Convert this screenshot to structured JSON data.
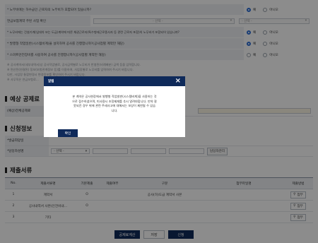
{
  "questions": [
    {
      "label": "* 노무비에는 하수급인 근로자의 노무비가 포함되어 있습니까?",
      "type": "radio",
      "yes": "예",
      "no": "아니오",
      "selected": "yes"
    },
    {
      "label": "연금보험계약 주된 사업 확인",
      "type": "select",
      "placeholder": "- 선택 -",
      "placeholder2": "- 선택 -"
    },
    {
      "label": "* 노무비에는 건설기계(임대차 또는 도급)계약에 따른 채권근로자(특수형태근로종사자 등 관련 근로자 포함)의 노무비가 포함되어 있습니까?",
      "type": "radio",
      "yes": "예",
      "no": "아니오",
      "selected": "yes"
    },
    {
      "label": "* 발행형 작업일반(시스템비계)을 설치하여 공사를 진행합니까?(공사업별 계약만 해당)",
      "type": "radio",
      "yes": "예",
      "no": "아니오",
      "selected": "yes"
    },
    {
      "label": "* 스마트안전장비를 사용하여 공사를 진행합니까?(공사업별 계약만 해당)",
      "type": "radio",
      "yes": "예",
      "no": "아니오",
      "selected": "none"
    }
  ],
  "notes": [
    "※ 공사계약서(세부내역서)상 공사작업별로, 공사금액별로 노무비가 반영된(비례배분) 금액 등을 입력합니다.",
    "※ 면산된(연결된) 정보(보험관계정보 등)를 이용하여, 사업장별로 노무비를 입력하여 주시기 바랍니다.",
    "   다만, 사업장 통합변경시 변경정보를 확인하여 주시기 바랍니다.",
    "※ 사무직은 연금보험료..."
  ],
  "section_premium": {
    "title": "예상 공제료",
    "row_label": "(예상)전체공제료",
    "right_label": "전체공제료"
  },
  "section_applicant": {
    "title": "신청정보",
    "row1_label": "*발급희망일",
    "row2_label": "*담당자성명",
    "select_placeholder": "- 선택 -",
    "lookup_button": "담당자관리"
  },
  "section_docs": {
    "title": "제출서류",
    "columns": [
      "No.",
      "제출서류명",
      "기본제출",
      "제출여부",
      "구분",
      "첨부파일명",
      "제출방법"
    ],
    "rows": [
      {
        "no": "1",
        "name": "계약서",
        "basic": "O",
        "submitted": "",
        "category": "공사(하)도급 계약서 사본",
        "file": "",
        "method": "첨부"
      },
      {
        "no": "2",
        "name": "공사내역서 사본(인건비내…",
        "basic": "O",
        "submitted": "",
        "category": "",
        "file": "",
        "method": "첨부"
      },
      {
        "no": "3",
        "name": "기타",
        "basic": "",
        "submitted": "",
        "category": "",
        "file": "",
        "method": "첨부"
      }
    ]
  },
  "bottom_buttons": {
    "calc": "공제료계산",
    "save": "저장",
    "apply": "신청"
  },
  "modal": {
    "title": "알림",
    "close": "×",
    "body_line1": "본 계약은 공사현장에서 발행형 작업발판(시스템비계)을 사용하는 것",
    "body_line2": "으로 접수하셨으며, 미사용시 조정제재를 추시 알려야합니다. 만약 잘",
    "body_line3": "못되진 경우 위에 관련 주세사고에 대해서는 보상이 제한될 수 있습",
    "body_line4": "니다.",
    "confirm": "확인"
  },
  "colors": {
    "navy": "#0f2a5a",
    "blue": "#2f6fd6",
    "red": "#d0392b",
    "label_bg": "#eef1f5"
  }
}
